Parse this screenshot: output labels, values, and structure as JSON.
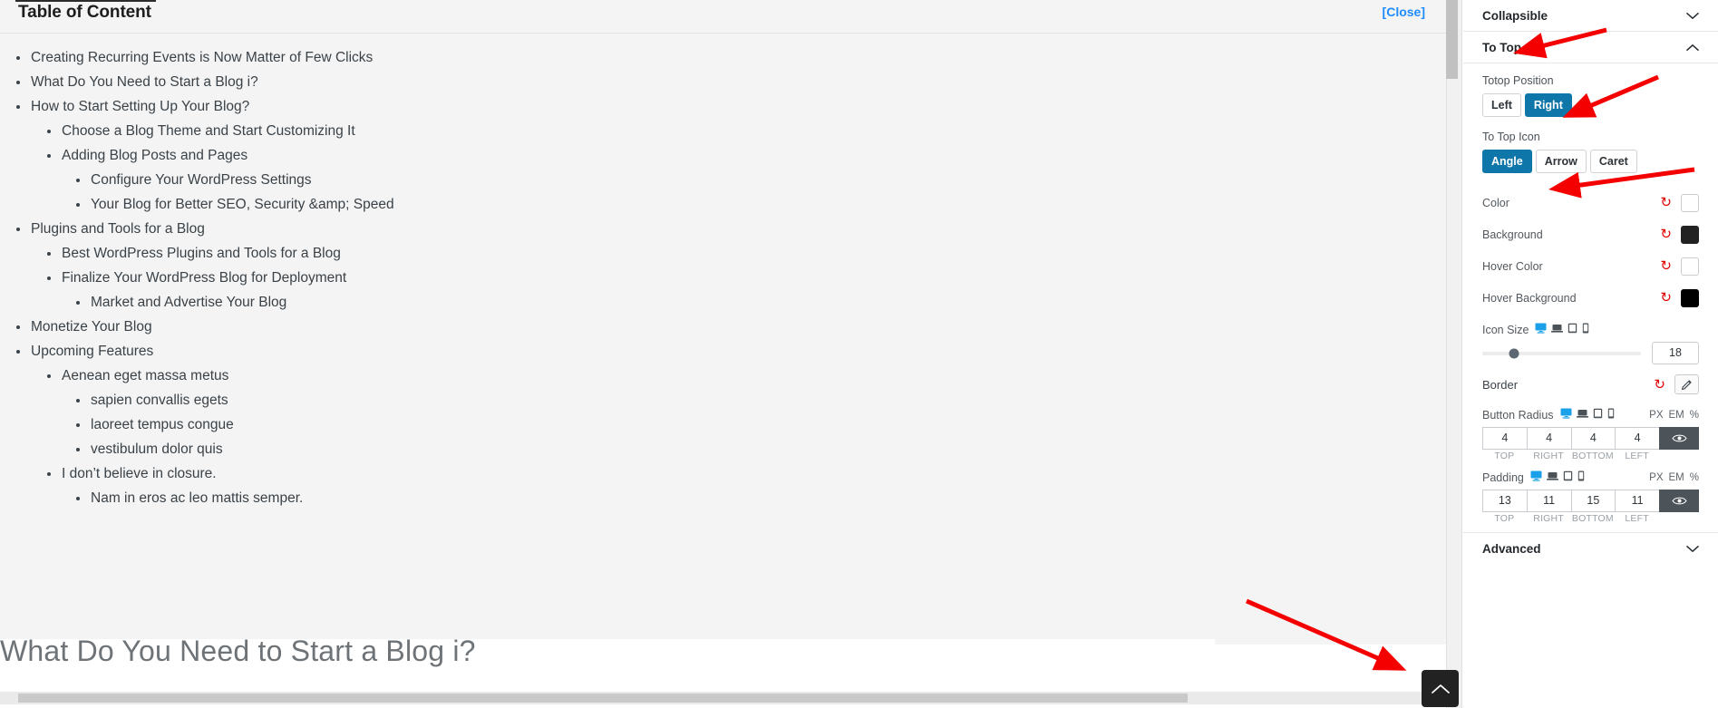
{
  "toc": {
    "title": "Table of Content",
    "close_label": "[Close]",
    "items": [
      {
        "label": "Creating Recurring Events is Now Matter of Few Clicks",
        "level": 1
      },
      {
        "label": "What Do You Need to Start a Blog i?",
        "level": 1
      },
      {
        "label": "How to Start Setting Up Your Blog?",
        "level": 1
      },
      {
        "label": "Choose a Blog Theme and Start Customizing It",
        "level": 2
      },
      {
        "label": "Adding Blog Posts and Pages",
        "level": 2
      },
      {
        "label": "Configure Your WordPress Settings",
        "level": 3
      },
      {
        "label": "Your Blog for Better SEO, Security &amp; Speed",
        "level": 3
      },
      {
        "label": "Plugins and Tools for a Blog",
        "level": 1
      },
      {
        "label": "Best WordPress Plugins and Tools for a Blog",
        "level": 2
      },
      {
        "label": "Finalize Your WordPress Blog for Deployment",
        "level": 2
      },
      {
        "label": "Market and Advertise Your Blog",
        "level": 3
      },
      {
        "label": "Monetize Your Blog",
        "level": 1
      },
      {
        "label": "Upcoming Features",
        "level": 1
      },
      {
        "label": "Aenean eget massa metus",
        "level": 2
      },
      {
        "label": "sapien convallis egets",
        "level": 3
      },
      {
        "label": "laoreet tempus congue",
        "level": 3
      },
      {
        "label": "vestibulum dolor quis",
        "level": 3
      },
      {
        "label": "I don’t believe in closure.",
        "level": 2
      },
      {
        "label": "Nam in eros ac leo mattis semper.",
        "level": 3
      }
    ]
  },
  "page": {
    "heading": "What Do You Need to Start a Blog i?"
  },
  "totop_button": {
    "icon": "angle-up-icon",
    "background": "#222222",
    "icon_color": "#ffffff"
  },
  "sidebar": {
    "sections": [
      {
        "label": "Collapsible",
        "state": "collapsed",
        "chevron": "chevron-down-icon"
      },
      {
        "label": "To Top",
        "state": "expanded",
        "chevron": "chevron-up-icon"
      },
      {
        "label": "Advanced",
        "state": "collapsed",
        "chevron": "chevron-down-icon"
      }
    ],
    "totop_position": {
      "label": "Totop Position",
      "options": [
        "Left",
        "Right"
      ],
      "selected": "Right"
    },
    "totop_icon": {
      "label": "To Top Icon",
      "options": [
        "Angle",
        "Arrow",
        "Caret"
      ],
      "selected": "Angle"
    },
    "colors": [
      {
        "label": "Color",
        "value": "#ffffff",
        "reset": "reset-icon"
      },
      {
        "label": "Background",
        "value": "#222222",
        "reset": "reset-icon"
      },
      {
        "label": "Hover Color",
        "value": "#ffffff",
        "reset": "reset-icon"
      },
      {
        "label": "Hover Background",
        "value": "#000000",
        "reset": "reset-icon"
      }
    ],
    "icon_size": {
      "label": "Icon Size",
      "value": "18",
      "devices": [
        "desktop-icon",
        "laptop-icon",
        "tablet-icon",
        "mobile-icon"
      ],
      "active_device": "desktop-icon"
    },
    "border": {
      "label": "Border",
      "reset": "reset-icon",
      "edit": "pencil-icon"
    },
    "button_radius": {
      "label": "Button Radius",
      "units": [
        "PX",
        "EM",
        "%"
      ],
      "selected_unit": "PX",
      "values": [
        "4",
        "4",
        "4",
        "4"
      ],
      "legend": [
        "TOP",
        "RIGHT",
        "BOTTOM",
        "LEFT"
      ],
      "link_icon": "eye-icon",
      "devices": [
        "desktop-icon",
        "laptop-icon",
        "tablet-icon",
        "mobile-icon"
      ],
      "active_device": "desktop-icon"
    },
    "padding": {
      "label": "Padding",
      "units": [
        "PX",
        "EM",
        "%"
      ],
      "selected_unit": "PX",
      "values": [
        "13",
        "11",
        "15",
        "11"
      ],
      "legend": [
        "TOP",
        "RIGHT",
        "BOTTOM",
        "LEFT"
      ],
      "link_icon": "eye-icon",
      "devices": [
        "desktop-icon",
        "laptop-icon",
        "tablet-icon",
        "mobile-icon"
      ],
      "active_device": "desktop-icon"
    }
  },
  "annotations": {
    "color": "#f50000",
    "arrows": [
      "to-top-section-arrow",
      "totop-position-arrow",
      "to-top-icon-arrow",
      "totop-button-arrow"
    ]
  }
}
